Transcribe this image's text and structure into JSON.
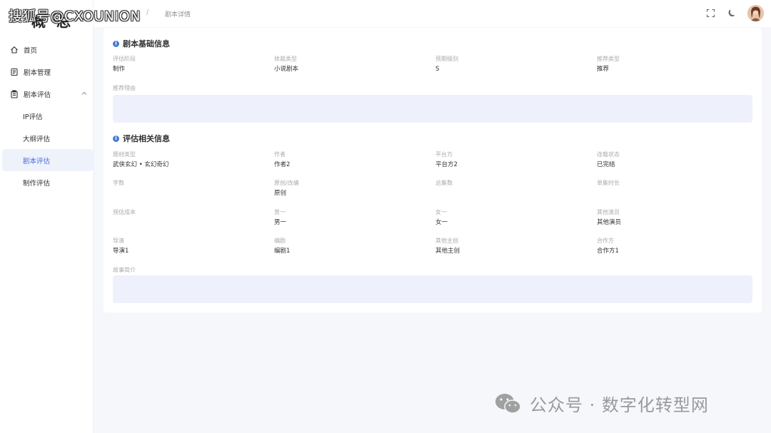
{
  "watermark_top": "搜狐号@CXOUNION",
  "logo_text": "概 总",
  "breadcrumb": {
    "separator": "/",
    "current": "剧本详情"
  },
  "sidebar": {
    "items": [
      {
        "label": "首页",
        "icon": "home-icon"
      },
      {
        "label": "剧本管理",
        "icon": "script-icon"
      },
      {
        "label": "剧本评估",
        "icon": "clipboard-icon",
        "expanded": true
      },
      {
        "label": "IP评估"
      },
      {
        "label": "大纲评估"
      },
      {
        "label": "剧本评估",
        "active": true
      },
      {
        "label": "制作评估"
      }
    ]
  },
  "header": {
    "fullscreen_icon": "fullscreen-icon",
    "theme_icon": "moon-icon",
    "avatar": "user-avatar"
  },
  "basic_section": {
    "title": "剧本基础信息",
    "fields": [
      {
        "label": "评估阶段",
        "value": "制作"
      },
      {
        "label": "体裁类型",
        "value": "小说剧本"
      },
      {
        "label": "预期级别",
        "value": "S"
      },
      {
        "label": "推荐类型",
        "value": "推荐"
      }
    ],
    "reason_label": "推荐理由"
  },
  "eval_section": {
    "title": "评估相关信息",
    "rows": [
      [
        {
          "label": "题材类型",
          "value": "武侠玄幻 • 玄幻奇幻"
        },
        {
          "label": "作者",
          "value": "作者2"
        },
        {
          "label": "平台方",
          "value": "平台方2"
        },
        {
          "label": "连载状态",
          "value": "已完结"
        }
      ],
      [
        {
          "label": "字数",
          "value": ""
        },
        {
          "label": "原创/改编",
          "value": "原创"
        },
        {
          "label": "总集数",
          "value": ""
        },
        {
          "label": "单集时长",
          "value": ""
        }
      ],
      [
        {
          "label": "预估成本",
          "value": ""
        },
        {
          "label": "男一",
          "value": "男一"
        },
        {
          "label": "女一",
          "value": "女一"
        },
        {
          "label": "其他演员",
          "value": "其他演员"
        }
      ],
      [
        {
          "label": "导演",
          "value": "导演1"
        },
        {
          "label": "编剧",
          "value": "编剧1"
        },
        {
          "label": "其他主创",
          "value": "其他主创"
        },
        {
          "label": "合作方",
          "value": "合作方1"
        }
      ]
    ],
    "synopsis_label": "故事简介"
  },
  "watermark_bottom": "公众号 · 数字化转型网",
  "colors": {
    "accent": "#4a78d9",
    "textarea_bg": "#eef1fb",
    "page_bg": "#f5f7fb"
  }
}
